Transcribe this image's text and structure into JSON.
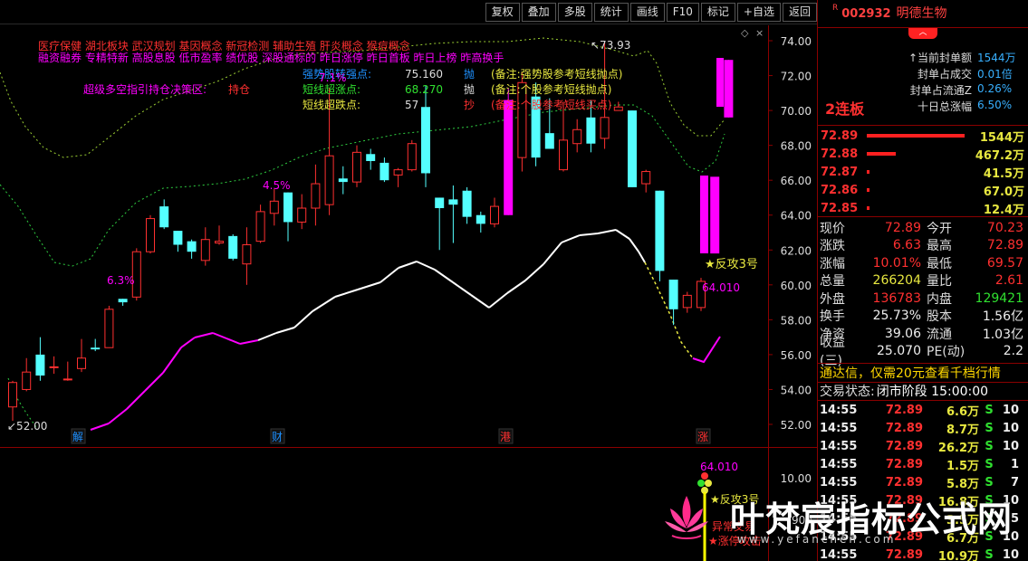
{
  "toolbar": {
    "buttons": [
      "复权",
      "叠加",
      "多股",
      "统计",
      "画线",
      "F10",
      "标记",
      "+自选",
      "返回"
    ]
  },
  "chart": {
    "price_axis": [
      "74.00",
      "72.00",
      "70.00",
      "68.00",
      "66.00",
      "64.00",
      "62.00",
      "60.00",
      "58.00",
      "56.00",
      "54.00",
      "52.00"
    ],
    "sub_axis": [
      "10.00"
    ],
    "concept_line_1": "医疗保健    湖北板块    武汉规划 基因概念 新冠检测 辅助生殖 肝炎概念 猴痘概念",
    "concept_line_2": "融资融券 专精特新 高股息股 低市盈率 绩优股 深股通标的 昨日涨停 昨日首板 昨日上榜 昨高换手",
    "strategy_label": "超级多空指引持仓决策区:",
    "strategy_value": "持仓",
    "indicator_rows": [
      {
        "name": "强势股转强点:",
        "value": "75.160",
        "tag": "抛",
        "note": "(备注:强势股参考短线抛点)"
      },
      {
        "name": "短线超涨点:",
        "value": "68.270",
        "tag": "抛",
        "note": "(备注:个股参考短线抛点)"
      },
      {
        "name": "短线超跌点:",
        "value": "57",
        "tag": "抄",
        "note": "(备注:个股参考短线买点)"
      }
    ],
    "high_label": "73.93",
    "low_label": "52.00",
    "pct_labels": [
      "6.3%",
      "4.5%",
      "7.1%"
    ],
    "counter_label": "★反攻3号",
    "counter_value": "64.010",
    "event_markers": [
      "解",
      "财",
      "港",
      "涨"
    ],
    "sub_value": "64.010",
    "sub_counter_label": "★反攻3号",
    "sub_abnormal": "异常交易",
    "sub_limit": "★涨停攻击",
    "sub_number": "900"
  },
  "chart_data": {
    "type": "candlestick",
    "ylim": [
      51.5,
      75
    ],
    "candles": [
      {
        "o": 53.0,
        "h": 54.5,
        "l": 52.2,
        "c": 54.4
      },
      {
        "o": 54.0,
        "h": 55.8,
        "l": 53.9,
        "c": 55.0
      },
      {
        "o": 56.0,
        "h": 57.0,
        "l": 54.5,
        "c": 54.8
      },
      {
        "o": 55.3,
        "h": 55.9,
        "l": 54.9,
        "c": 55.3
      },
      {
        "o": 54.6,
        "h": 55.6,
        "l": 54.5,
        "c": 54.6
      },
      {
        "o": 55.2,
        "h": 56.9,
        "l": 55.0,
        "c": 55.8
      },
      {
        "o": 56.4,
        "h": 56.9,
        "l": 56.2,
        "c": 56.3
      },
      {
        "o": 56.4,
        "h": 58.8,
        "l": 56.4,
        "c": 58.6
      },
      {
        "o": 59.2,
        "h": 59.2,
        "l": 58.8,
        "c": 59.0
      },
      {
        "o": 59.3,
        "h": 62.1,
        "l": 59.1,
        "c": 61.9
      },
      {
        "o": 61.9,
        "h": 64.0,
        "l": 61.8,
        "c": 63.8
      },
      {
        "o": 64.5,
        "h": 64.9,
        "l": 63.2,
        "c": 63.3
      },
      {
        "o": 63.1,
        "h": 63.1,
        "l": 61.9,
        "c": 62.3
      },
      {
        "o": 62.5,
        "h": 62.6,
        "l": 61.5,
        "c": 61.9
      },
      {
        "o": 61.4,
        "h": 63.3,
        "l": 61.1,
        "c": 62.6
      },
      {
        "o": 62.4,
        "h": 63.4,
        "l": 62.3,
        "c": 62.5
      },
      {
        "o": 62.8,
        "h": 62.9,
        "l": 61.4,
        "c": 61.5
      },
      {
        "o": 61.2,
        "h": 63.3,
        "l": 60.0,
        "c": 62.3
      },
      {
        "o": 62.5,
        "h": 64.6,
        "l": 62.4,
        "c": 64.2
      },
      {
        "o": 64.1,
        "h": 65.5,
        "l": 63.4,
        "c": 64.8
      },
      {
        "o": 65.3,
        "h": 65.3,
        "l": 62.5,
        "c": 63.6
      },
      {
        "o": 63.6,
        "h": 65.2,
        "l": 63.2,
        "c": 64.4
      },
      {
        "o": 64.4,
        "h": 66.9,
        "l": 63.4,
        "c": 65.8
      },
      {
        "o": 64.6,
        "h": 71.3,
        "l": 64.0,
        "c": 67.4
      },
      {
        "o": 66.1,
        "h": 66.8,
        "l": 65.2,
        "c": 65.9
      },
      {
        "o": 65.9,
        "h": 68.0,
        "l": 65.6,
        "c": 67.6
      },
      {
        "o": 67.5,
        "h": 67.8,
        "l": 66.6,
        "c": 67.1
      },
      {
        "o": 67.0,
        "h": 67.3,
        "l": 65.9,
        "c": 66.0
      },
      {
        "o": 66.3,
        "h": 66.7,
        "l": 65.6,
        "c": 66.6
      },
      {
        "o": 66.6,
        "h": 68.3,
        "l": 66.5,
        "c": 68.1
      },
      {
        "o": 70.2,
        "h": 71.4,
        "l": 65.6,
        "c": 66.4
      },
      {
        "o": 65.0,
        "h": 65.0,
        "l": 62.0,
        "c": 64.4
      },
      {
        "o": 64.9,
        "h": 65.7,
        "l": 62.4,
        "c": 64.6
      },
      {
        "o": 65.4,
        "h": 65.6,
        "l": 63.5,
        "c": 63.9
      },
      {
        "o": 64.0,
        "h": 64.2,
        "l": 63.0,
        "c": 63.5
      },
      {
        "o": 63.5,
        "h": 65.0,
        "l": 63.3,
        "c": 64.5
      },
      {
        "o": 64.0,
        "h": 71.3,
        "l": 64.0,
        "c": 70.6
      },
      {
        "o": 67.3,
        "h": 72.2,
        "l": 66.5,
        "c": 71.6
      },
      {
        "o": 70.8,
        "h": 71.6,
        "l": 66.8,
        "c": 67.3
      },
      {
        "o": 68.7,
        "h": 70.7,
        "l": 67.8,
        "c": 67.8
      },
      {
        "o": 66.6,
        "h": 70.5,
        "l": 66.5,
        "c": 68.3
      },
      {
        "o": 68.1,
        "h": 69.5,
        "l": 67.6,
        "c": 68.9
      },
      {
        "o": 69.6,
        "h": 70.6,
        "l": 67.6,
        "c": 68.1
      },
      {
        "o": 68.4,
        "h": 73.9,
        "l": 67.8,
        "c": 69.6
      },
      {
        "o": 70.0,
        "h": 70.5,
        "l": 70.0,
        "c": 70.2
      },
      {
        "o": 70.0,
        "h": 70.0,
        "l": 65.6,
        "c": 65.6
      },
      {
        "o": 65.8,
        "h": 66.6,
        "l": 65.3,
        "c": 66.5
      },
      {
        "o": 65.4,
        "h": 65.4,
        "l": 60.2,
        "c": 60.8
      },
      {
        "o": 60.3,
        "h": 60.3,
        "l": 57.7,
        "c": 58.6
      },
      {
        "o": 58.7,
        "h": 59.6,
        "l": 58.4,
        "c": 59.4
      },
      {
        "o": 58.7,
        "h": 60.4,
        "l": 58.5,
        "c": 60.2
      },
      {
        "o": 61.8,
        "h": 61.8,
        "l": 61.8,
        "c": 66.2
      },
      {
        "o": 69.6,
        "h": 72.9,
        "l": 69.6,
        "c": 72.9
      }
    ]
  },
  "panel": {
    "stock_code": "002932",
    "stock_name": "明德生物",
    "limit_count": "2连板",
    "limit_rows": [
      {
        "k": "当前封单额",
        "v": "1544万"
      },
      {
        "k": "封单占成交",
        "v": "0.01倍"
      },
      {
        "k": "封单占流通Z",
        "v": "0.26%"
      },
      {
        "k": "十日总涨幅",
        "v": "6.50%"
      }
    ],
    "order_book": [
      {
        "price": "72.89",
        "bar": 100,
        "vol": "1544万"
      },
      {
        "price": "72.88",
        "bar": 30,
        "vol": "467.2万"
      },
      {
        "price": "72.87",
        "bar": 3,
        "vol": "41.5万"
      },
      {
        "price": "72.86",
        "bar": 3,
        "vol": "67.0万"
      },
      {
        "price": "72.85",
        "bar": 3,
        "vol": "12.4万"
      }
    ],
    "quote": [
      {
        "l": "现价",
        "v": "72.89",
        "vc": "red",
        "l2": "今开",
        "v2": "70.23",
        "v2c": "red"
      },
      {
        "l": "涨跌",
        "v": "6.63",
        "vc": "red",
        "l2": "最高",
        "v2": "72.89",
        "v2c": "red"
      },
      {
        "l": "涨幅",
        "v": "10.01%",
        "vc": "red",
        "l2": "最低",
        "v2": "69.57",
        "v2c": "red"
      },
      {
        "l": "总量",
        "v": "266204",
        "vc": "yellow",
        "l2": "量比",
        "v2": "2.61",
        "v2c": "red"
      },
      {
        "l": "外盘",
        "v": "136783",
        "vc": "red",
        "l2": "内盘",
        "v2": "129421",
        "v2c": "green"
      },
      {
        "l": "换手",
        "v": "25.73%",
        "vc": "white",
        "l2": "股本",
        "v2": "1.56亿",
        "v2c": "white"
      },
      {
        "l": "净资",
        "v": "39.06",
        "vc": "white",
        "l2": "流通",
        "v2": "1.03亿",
        "v2c": "white"
      },
      {
        "l": "收益(三)",
        "v": "25.070",
        "vc": "white",
        "l2": "PE(动)",
        "v2": "2.2",
        "v2c": "white"
      }
    ],
    "ad_text": "通达信，仅需20元查看千档行情",
    "trade_status_label": "交易状态:",
    "trade_status_value": "闭市阶段 15:00:00",
    "ticks": [
      {
        "t": "14:55",
        "p": "72.89",
        "v": "6.6万",
        "s": "S",
        "n": "10"
      },
      {
        "t": "14:55",
        "p": "72.89",
        "v": "8.7万",
        "s": "S",
        "n": "10"
      },
      {
        "t": "14:55",
        "p": "72.89",
        "v": "26.2万",
        "s": "S",
        "n": "10"
      },
      {
        "t": "14:55",
        "p": "72.89",
        "v": "1.5万",
        "s": "S",
        "n": "1"
      },
      {
        "t": "14:55",
        "p": "72.89",
        "v": "5.8万",
        "s": "S",
        "n": "7"
      },
      {
        "t": "14:55",
        "p": "72.89",
        "v": "16.8万",
        "s": "S",
        "n": "10"
      },
      {
        "t": "14:55",
        "p": "72.89",
        "v": "3.5万",
        "s": "S",
        "n": "5"
      },
      {
        "t": "14:55",
        "p": "72.89",
        "v": "6.7万",
        "s": "S",
        "n": "10"
      },
      {
        "t": "14:55",
        "p": "72.89",
        "v": "10.9万",
        "s": "S",
        "n": "10"
      }
    ]
  },
  "watermark": {
    "text": "叶梵宸指标公式网",
    "url": "www.yefanchen.com"
  }
}
